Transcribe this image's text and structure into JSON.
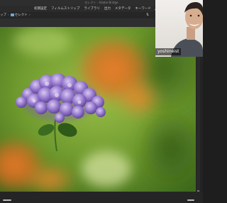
{
  "window": {
    "title": "セレクト - Adobe Bridge"
  },
  "workspace_tabs": [
    {
      "label": "初期設定"
    },
    {
      "label": "フィルムストリップ"
    },
    {
      "label": "ライブラリ"
    },
    {
      "label": "出力"
    },
    {
      "label": "メタデータ"
    },
    {
      "label": "キーワード"
    }
  ],
  "path": {
    "parent": "ップ",
    "current": "セレクト"
  },
  "webcam": {
    "name": "yoshineist"
  },
  "colors": {
    "accent_folder": "#6fa8d8",
    "ui_dark": "#232323"
  }
}
